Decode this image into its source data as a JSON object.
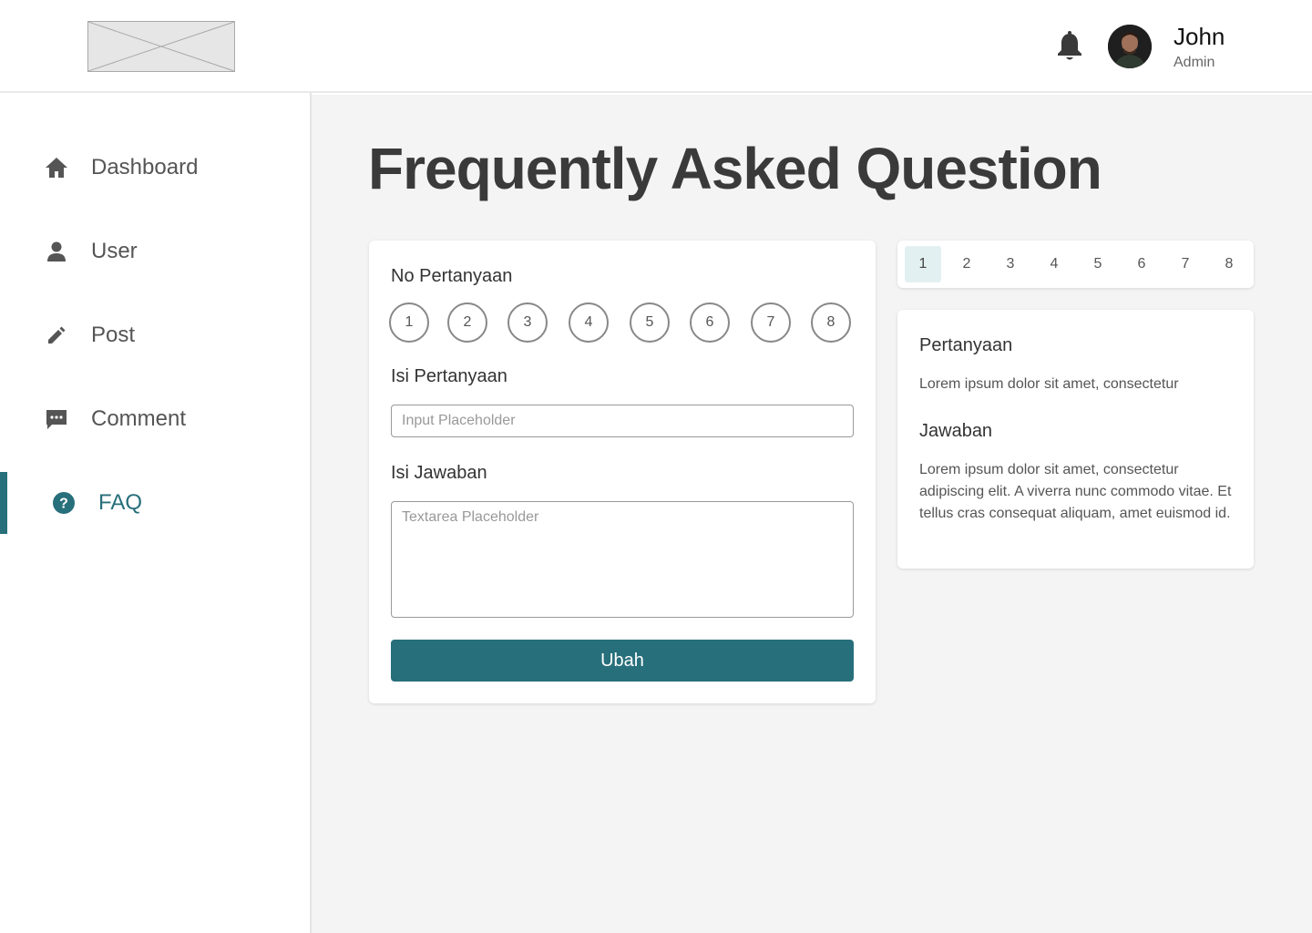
{
  "header": {
    "user_name": "John",
    "user_role": "Admin",
    "bell_icon": "bell-icon",
    "logo": "image-placeholder-logo"
  },
  "sidebar": {
    "items": [
      {
        "label": "Dashboard",
        "icon": "home-icon",
        "active": false
      },
      {
        "label": "User",
        "icon": "user-icon",
        "active": false
      },
      {
        "label": "Post",
        "icon": "pencil-icon",
        "active": false
      },
      {
        "label": "Comment",
        "icon": "comment-icon",
        "active": false
      },
      {
        "label": "FAQ",
        "icon": "question-circle-icon",
        "active": true
      }
    ]
  },
  "main": {
    "title": "Frequently Asked Question",
    "form": {
      "no_label": "No Pertanyaan",
      "numbers": [
        "1",
        "2",
        "3",
        "4",
        "5",
        "6",
        "7",
        "8"
      ],
      "question_label": "Isi Pertanyaan",
      "question_placeholder": "Input Placeholder",
      "answer_label": "Isi Jawaban",
      "answer_placeholder": "Textarea Placeholder",
      "submit_label": "Ubah"
    },
    "pager": {
      "pages": [
        "1",
        "2",
        "3",
        "4",
        "5",
        "6",
        "7",
        "8"
      ],
      "active_page": "1"
    },
    "detail": {
      "question_heading": "Pertanyaan",
      "question_text": "Lorem ipsum dolor sit amet, consectetur",
      "answer_heading": "Jawaban",
      "answer_text": "Lorem ipsum dolor sit amet, consectetur adipiscing elit. A viverra nunc commodo vitae. Et tellus cras consequat aliquam, amet euismod id."
    }
  },
  "colors": {
    "accent": "#276f7b",
    "active_page_bg": "#e3f0f1",
    "main_bg": "#f4f4f4",
    "title": "#3a3a3a"
  }
}
